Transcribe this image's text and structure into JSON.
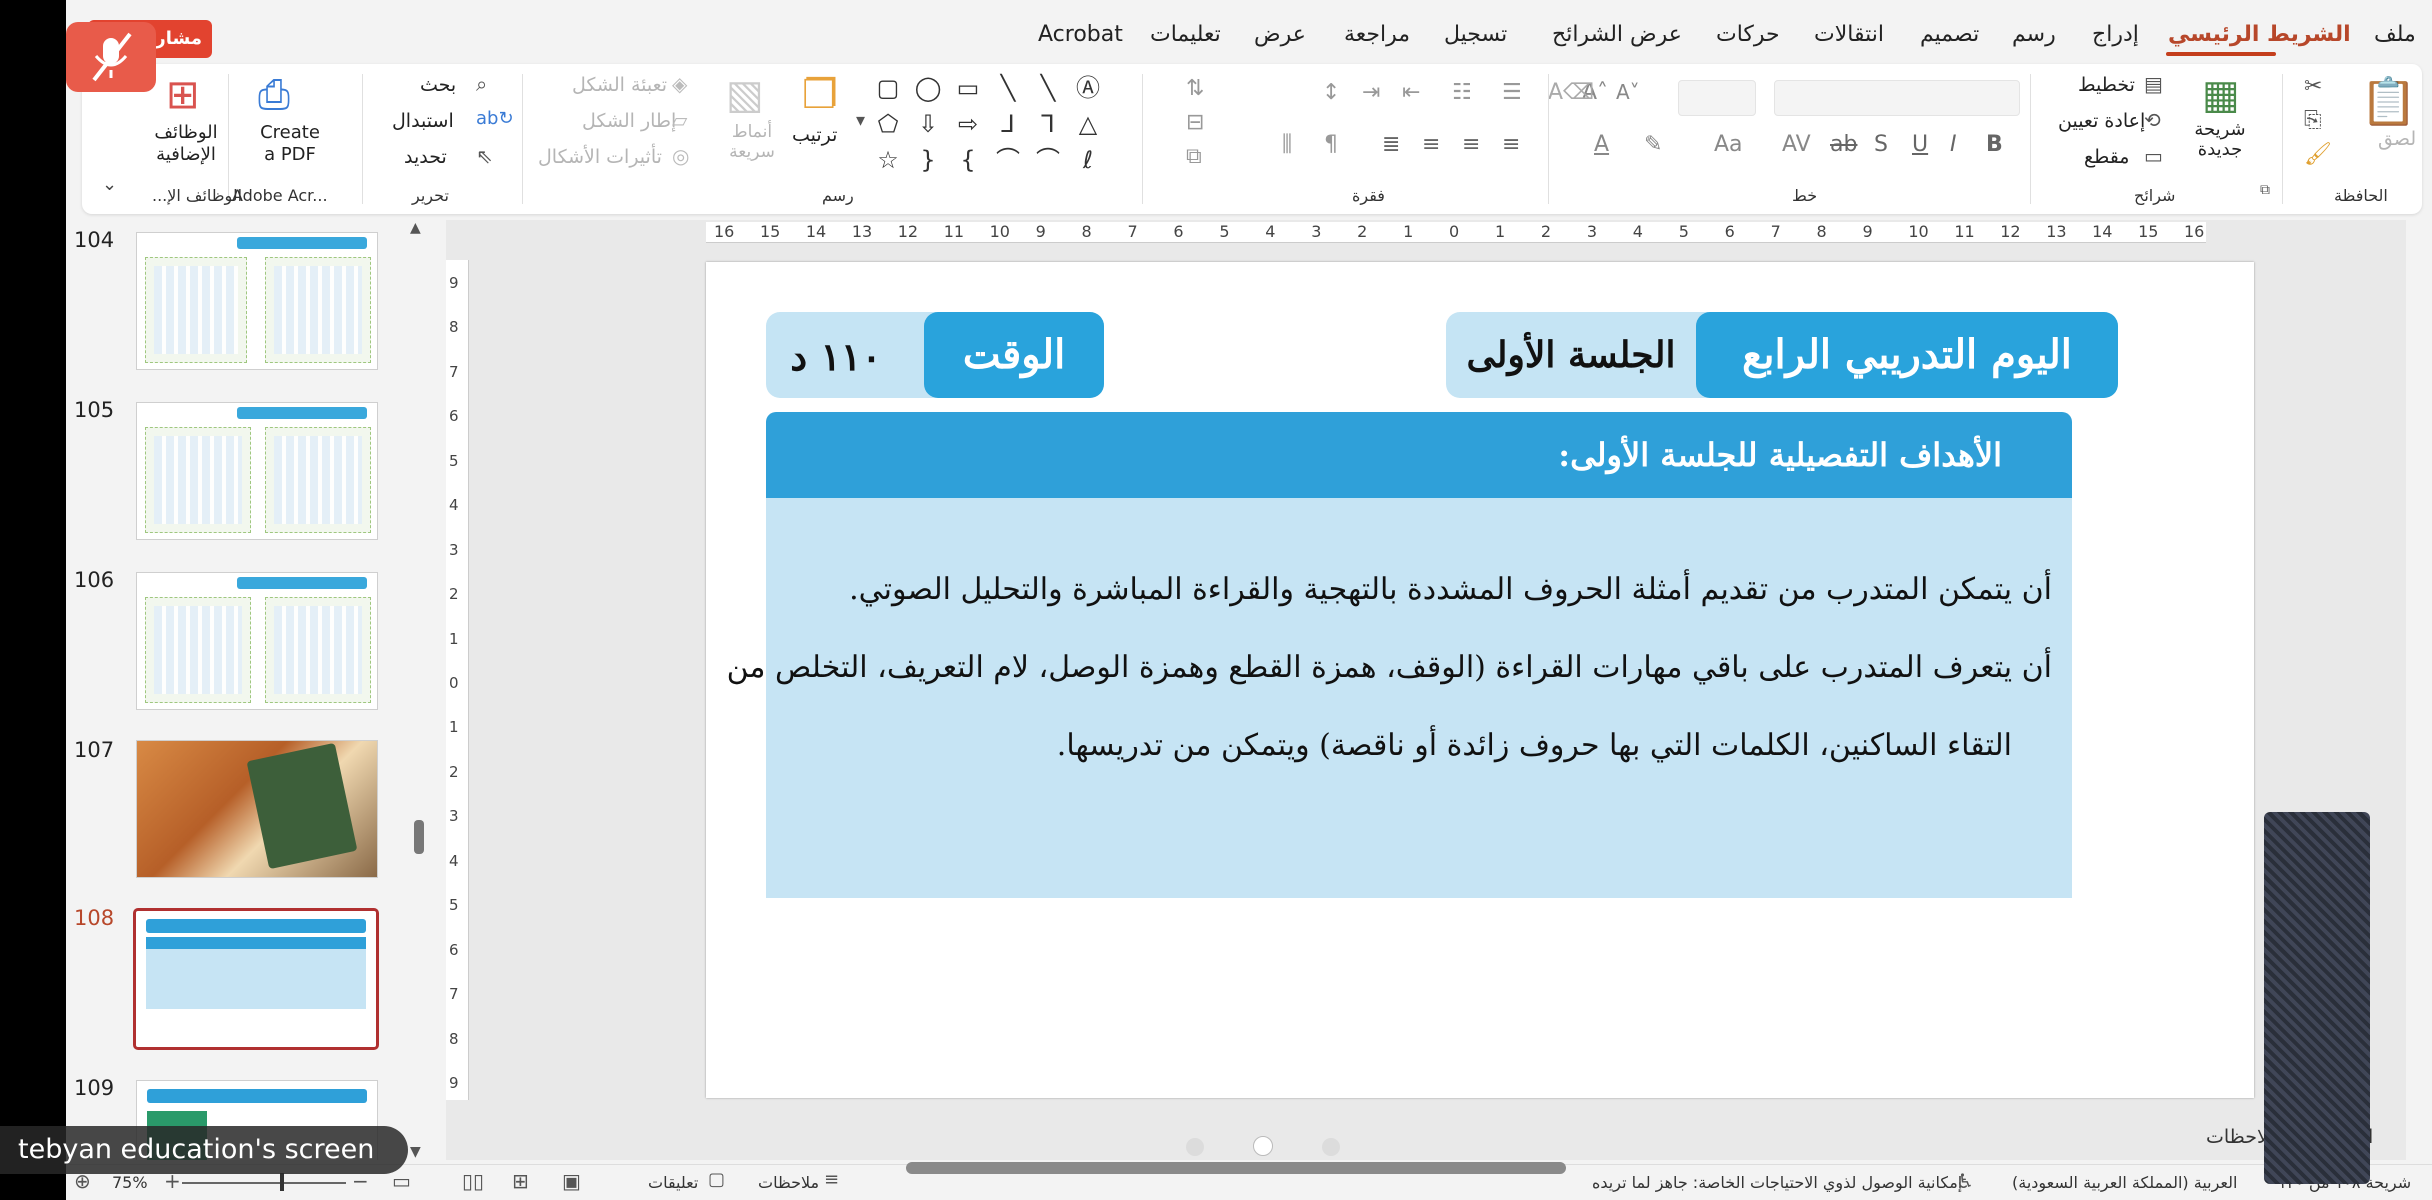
{
  "ribbon_tabs": [
    {
      "label": "ملف"
    },
    {
      "label": "الشريط الرئيسي"
    },
    {
      "label": "إدراج"
    },
    {
      "label": "رسم"
    },
    {
      "label": "تصميم"
    },
    {
      "label": "انتقالات"
    },
    {
      "label": "حركات"
    },
    {
      "label": "عرض الشرائح"
    },
    {
      "label": "تسجيل"
    },
    {
      "label": "مراجعة"
    },
    {
      "label": "عرض"
    },
    {
      "label": "تعليمات"
    },
    {
      "label": "Acrobat"
    }
  ],
  "ribbon": {
    "clipboard": {
      "paste": "لصق",
      "group": "الحافظة"
    },
    "slides": {
      "new_slide": "شريحة جديدة",
      "layout": "تخطيط",
      "reset": "إعادة تعيين",
      "section": "مقطع",
      "group": "شرائح"
    },
    "font": {
      "group": "خط"
    },
    "paragraph": {
      "group": "فقرة"
    },
    "drawing": {
      "arrange": "ترتيب",
      "styles": "أنماط سريعة",
      "fill": "تعبئة الشكل",
      "outline": "إطار الشكل",
      "effects": "تأثيرات الأشكال",
      "group": "رسم"
    },
    "editing": {
      "find": "بحث",
      "replace": "استبدال",
      "select": "تحديد",
      "group": "تحرير"
    },
    "adobe": {
      "create": "Create a PDF",
      "group": "Adobe Acr..."
    },
    "addins": {
      "label": "الوظائف الإضافية",
      "group": "الوظائف الإ..."
    }
  },
  "thumbnails": [
    {
      "num": "104",
      "selected": false
    },
    {
      "num": "105",
      "selected": false
    },
    {
      "num": "106",
      "selected": false
    },
    {
      "num": "107",
      "selected": false
    },
    {
      "num": "108",
      "selected": true
    },
    {
      "num": "109",
      "selected": false
    }
  ],
  "ruler_h": [
    "16",
    "15",
    "14",
    "13",
    "12",
    "11",
    "10",
    "9",
    "8",
    "7",
    "6",
    "5",
    "4",
    "3",
    "2",
    "1",
    "0",
    "1",
    "2",
    "3",
    "4",
    "5",
    "6",
    "7",
    "8",
    "9",
    "10",
    "11",
    "12",
    "13",
    "14",
    "15",
    "16"
  ],
  "ruler_v": [
    "9",
    "8",
    "7",
    "6",
    "5",
    "4",
    "3",
    "2",
    "1",
    "0",
    "1",
    "2",
    "3",
    "4",
    "5",
    "6",
    "7",
    "8",
    "9"
  ],
  "slide": {
    "day_title": "اليوم التدريبي الرابع",
    "session": "الجلسة الأولى",
    "time_label": "الوقت",
    "time_value": "١١٠ د",
    "objectives_title": "الأهداف التفصيلية للجلسة الأولى:",
    "objective_1": "أن يتمكن المتدرب من تقديم أمثلة الحروف المشددة بالتهجية والقراءة المباشرة والتحليل الصوتي.",
    "objective_2a": "أن يتعرف المتدرب على باقي مهارات القراءة (الوقف، همزة القطع وهمزة الوصل، لام التعريف، التخلص من",
    "objective_2b": "التقاء الساكنين، الكلمات التي بها حروف زائدة أو ناقصة) ويتمكن من تدريسها."
  },
  "notes_label": "انقر لإضافة ملاحظات",
  "status": {
    "slide_of": "شريحة ١٠٨ من ١٢٠",
    "language": "العربية (المملكة العربية السعودية)",
    "accessibility": "إمكانية الوصول لذوي الاحتياجات الخاصة: جاهز لما تريده",
    "notes": "ملاحظات",
    "comments": "تعليقات",
    "zoom": "75%"
  },
  "overlay": {
    "share": "مشاركة",
    "caption": "tebyan education's screen"
  }
}
